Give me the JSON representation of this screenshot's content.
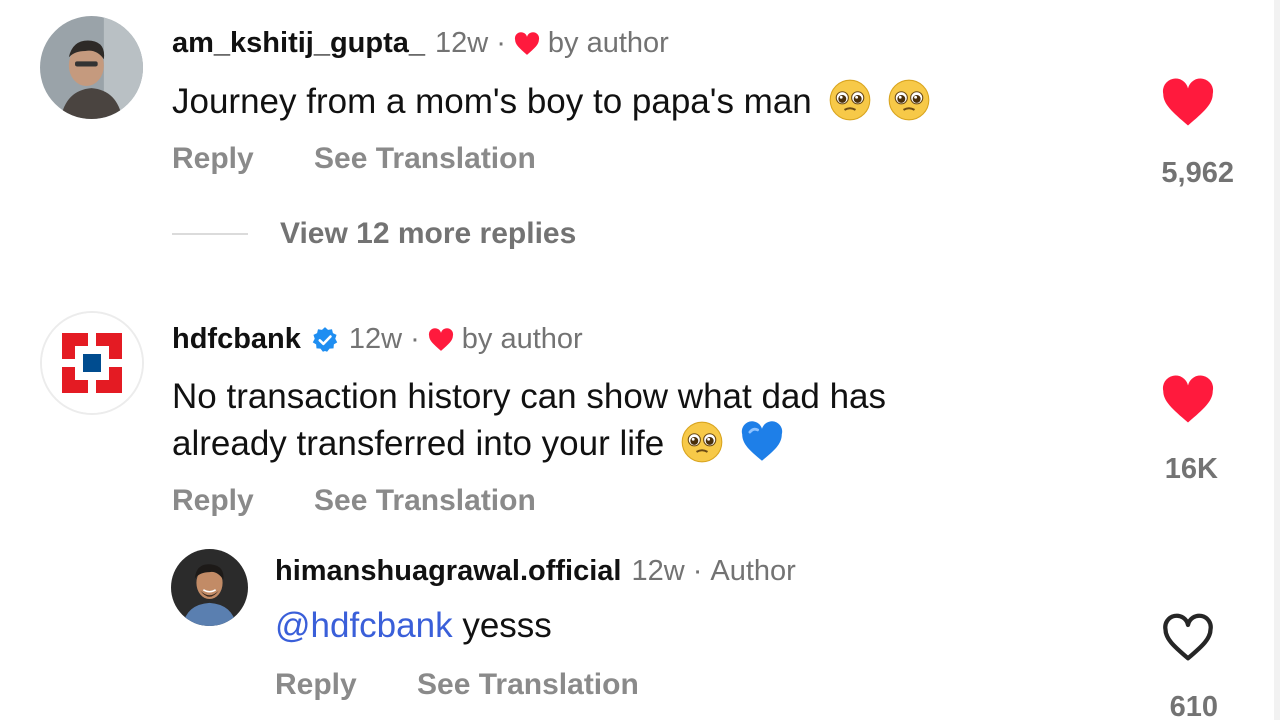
{
  "colors": {
    "like_red": "#ff1a3d",
    "muted_grey": "#737373",
    "mention_blue": "#3a5fd9",
    "verified_blue": "#1f8ef1",
    "hdfc_red": "#e41b23",
    "hdfc_blue": "#004c8f"
  },
  "comments": [
    {
      "username": "am_kshitij_gupta_",
      "time": "12w",
      "badge": "by author",
      "text": "Journey from a mom's boy to papa's man",
      "emojis": [
        "pleading-face",
        "pleading-face"
      ],
      "actions": {
        "reply": "Reply",
        "translate": "See Translation"
      },
      "like_count": "5,962",
      "liked": true,
      "view_replies": "View 12 more replies"
    },
    {
      "username": "hdfcbank",
      "verified": true,
      "time": "12w",
      "badge": "by author",
      "text_line1": "No transaction history can show what dad has",
      "text_line2": "already transferred into your life",
      "emojis": [
        "pleading-face",
        "blue-heart"
      ],
      "actions": {
        "reply": "Reply",
        "translate": "See Translation"
      },
      "like_count": "16K",
      "liked": true
    },
    {
      "username": "himanshuagrawal.official",
      "time": "12w",
      "badge": "Author",
      "mention": "@hdfcbank",
      "text": "yesss",
      "actions": {
        "reply": "Reply",
        "translate": "See Translation"
      },
      "like_count": "610",
      "liked": false
    }
  ]
}
